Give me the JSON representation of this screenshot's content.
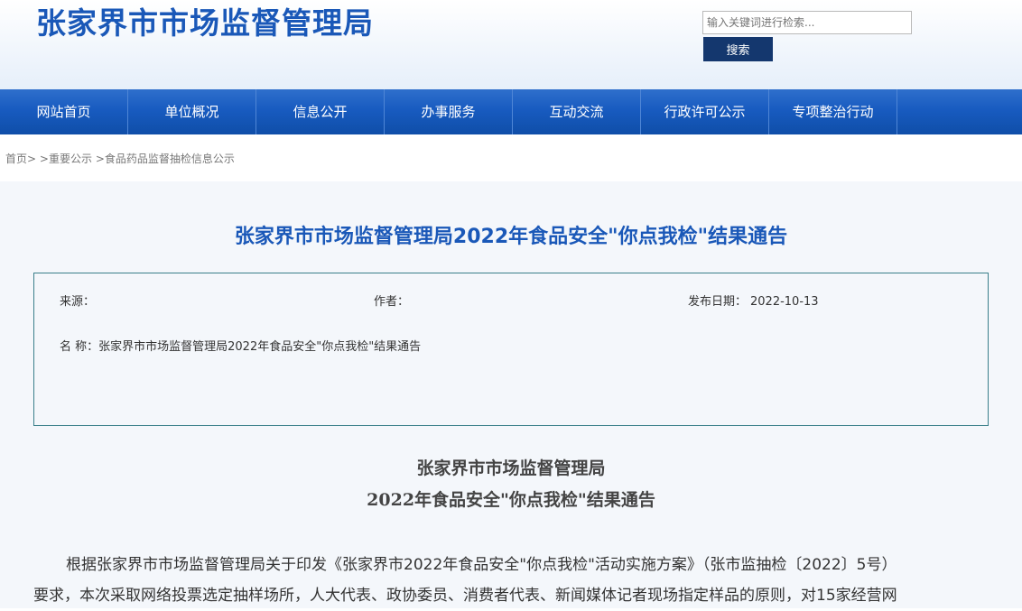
{
  "header": {
    "site_title": "张家界市市场监督管理局",
    "search_placeholder": "输入关键词进行检索...",
    "search_button": "搜索"
  },
  "nav": {
    "items": [
      "网站首页",
      "单位概况",
      "信息公开",
      "办事服务",
      "互动交流",
      "行政许可公示",
      "专项整治行动"
    ]
  },
  "breadcrumb": {
    "items": [
      "首页",
      "重要公示",
      "食品药品监督抽检信息公示"
    ],
    "sep": ">"
  },
  "article": {
    "title": "张家界市市场监督管理局2022年食品安全\"你点我检\"结果通告",
    "source_label": "来源：",
    "source_value": "",
    "author_label": "作者：",
    "author_value": "",
    "date_label": "发布日期：",
    "date_value": "2022-10-13",
    "name_label": "名 称：",
    "name_value": "张家界市市场监督管理局2022年食品安全\"你点我检\"结果通告",
    "heading_line1": "张家界市市场监督管理局",
    "heading_line2": "2022年食品安全\"你点我检\"结果通告",
    "body_line1": "根据张家界市市场监督管理局关于印发《张家界市2022年食品安全\"你点我检\"活动实施方案》（张市监抽检〔2022〕5号）",
    "body_line2": "要求，本次采取网络投票选定抽样场所，人大代表、政协委员、消费者代表、新闻媒体记者现场指定样品的原则，对15家经营网"
  },
  "colors": {
    "brand_blue": "#1a58b8",
    "nav_blue": "#185bc0",
    "search_button": "#14376e",
    "box_border": "#3a7f8a"
  }
}
